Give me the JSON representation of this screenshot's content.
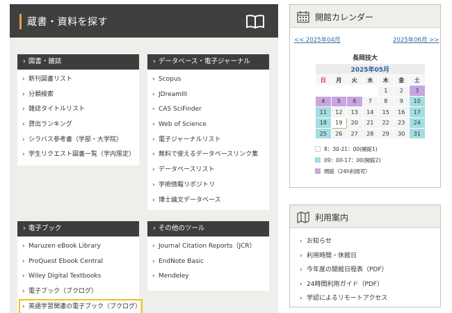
{
  "search": {
    "title": "蔵書・資料を探す",
    "icon": "book-icon"
  },
  "books": {
    "header": "図書・雑誌",
    "items": [
      "新刊図書リスト",
      "分類検索",
      "雑誌タイトルリスト",
      "貸出ランキング",
      "シラバス参考書（学部・大学院）",
      "学生リクエスト図書一覧（学内限定）"
    ]
  },
  "databases": {
    "header": "データベース・電子ジャーナル",
    "items": [
      "Scopus",
      "JDreamIII",
      "CAS SciFinder",
      "Web of Science",
      "電子ジャーナルリスト",
      "無料で使えるデータベースリンク集",
      "データベースリスト",
      "学術情報リポジトリ",
      "博士論文データベース"
    ]
  },
  "ebooks": {
    "header": "電子ブック",
    "items": [
      "Maruzen eBook Library",
      "ProQuest Ebook Central",
      "Wiley Digital Textbooks",
      "電子ブック（ブクログ）",
      "英語学習関連の電子ブック（ブクログ）"
    ]
  },
  "tools": {
    "header": "その他のツール",
    "items": [
      "Journal Citation Reports（JCR）",
      "EndNote Basic",
      "Mendeley"
    ]
  },
  "calendar": {
    "title": "開館カレンダー",
    "icon": "calendar-icon",
    "prev": "<< 2025年04月",
    "next": "2025年06月 >>",
    "organization": "長岡技大",
    "month": "2025年05月",
    "weekdays": [
      "日",
      "月",
      "火",
      "水",
      "木",
      "金",
      "土"
    ],
    "colors": {
      "purple": "#c8a6df",
      "cyan": "#a3dde0",
      "white": "#f4f4f4"
    },
    "weeks": [
      [
        {
          "d": "",
          "t": "n"
        },
        {
          "d": "",
          "t": "n"
        },
        {
          "d": "",
          "t": "n"
        },
        {
          "d": "",
          "t": "n"
        },
        {
          "d": "1",
          "t": "w"
        },
        {
          "d": "2",
          "t": "w"
        },
        {
          "d": "3",
          "t": "p"
        }
      ],
      [
        {
          "d": "4",
          "t": "p"
        },
        {
          "d": "5",
          "t": "p"
        },
        {
          "d": "6",
          "t": "p"
        },
        {
          "d": "7",
          "t": "w"
        },
        {
          "d": "8",
          "t": "w"
        },
        {
          "d": "9",
          "t": "w"
        },
        {
          "d": "10",
          "t": "c"
        }
      ],
      [
        {
          "d": "11",
          "t": "c"
        },
        {
          "d": "12",
          "t": "w"
        },
        {
          "d": "13",
          "t": "w"
        },
        {
          "d": "14",
          "t": "w"
        },
        {
          "d": "15",
          "t": "w"
        },
        {
          "d": "16",
          "t": "w"
        },
        {
          "d": "17",
          "t": "c"
        }
      ],
      [
        {
          "d": "18",
          "t": "c"
        },
        {
          "d": "19",
          "t": "today"
        },
        {
          "d": "20",
          "t": "w"
        },
        {
          "d": "21",
          "t": "w"
        },
        {
          "d": "22",
          "t": "w"
        },
        {
          "d": "23",
          "t": "w"
        },
        {
          "d": "24",
          "t": "c"
        }
      ],
      [
        {
          "d": "25",
          "t": "c"
        },
        {
          "d": "26",
          "t": "w"
        },
        {
          "d": "27",
          "t": "w"
        },
        {
          "d": "28",
          "t": "w"
        },
        {
          "d": "29",
          "t": "w"
        },
        {
          "d": "30",
          "t": "w"
        },
        {
          "d": "31",
          "t": "c"
        }
      ]
    ],
    "legend": [
      {
        "label": "8：30-21：00(開館1)",
        "color": "#ffffff"
      },
      {
        "label": "09：00-17：00(開館2)",
        "color": "#a3dde0"
      },
      {
        "label": "閉館（24h利用可）",
        "color": "#c8a6df"
      }
    ]
  },
  "guide": {
    "title": "利用案内",
    "icon": "map-icon",
    "items": [
      "お知らせ",
      "利用時間・休館日",
      "今年度の開館日程表（PDF）",
      "24時間利用ガイド（PDF）",
      "学認によるリモートアクセス"
    ]
  }
}
